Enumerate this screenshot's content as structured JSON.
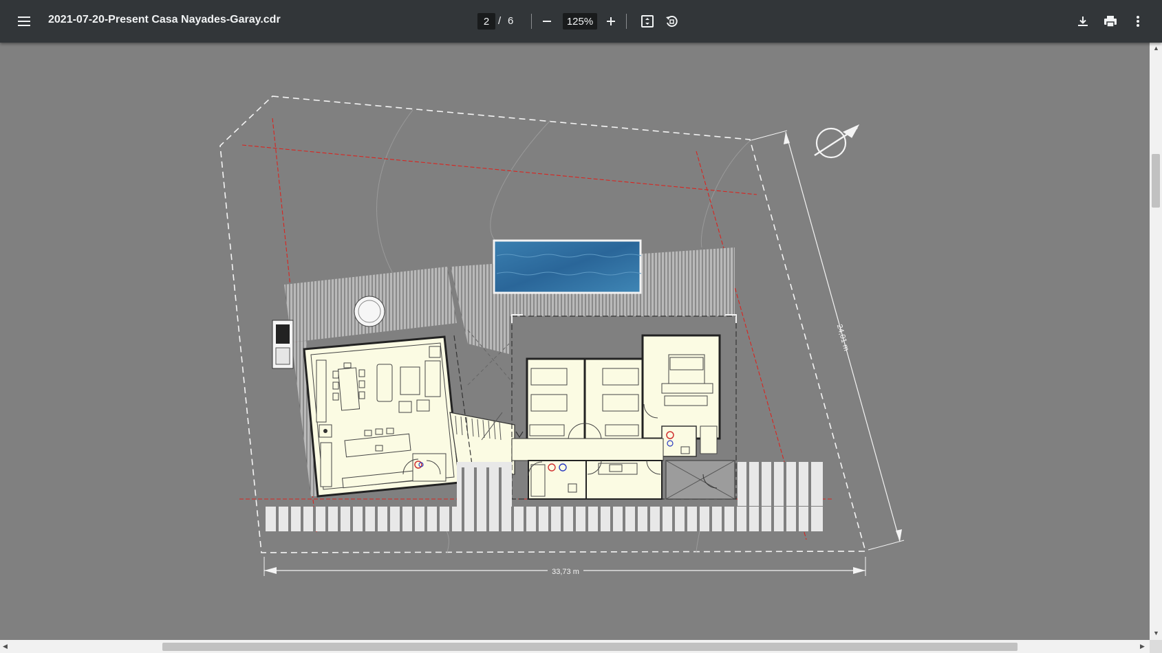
{
  "toolbar": {
    "menu_icon": "hamburger-menu-icon",
    "title": "2021-07-20-Present Casa Nayades-Garay.cdr",
    "page_current": "2",
    "page_separator": "/",
    "page_total": "6",
    "zoom_out_icon": "minus-icon",
    "zoom_value": "125%",
    "zoom_in_icon": "plus-icon",
    "fit_icon": "fit-to-page-icon",
    "rotate_icon": "rotate-counterclockwise-icon",
    "download_icon": "download-icon",
    "print_icon": "print-icon",
    "more_icon": "more-vertical-icon"
  },
  "drawing": {
    "width_dimension": "33,73 m",
    "depth_dimension": "24,01 m",
    "north_icon": "north-arrow-icon"
  },
  "colors": {
    "toolbar_bg": "#323639",
    "viewer_bg": "#808080",
    "room_fill": "#fbfbe3",
    "axis_line": "#d9241f",
    "pool_water": "#2f6fa0"
  }
}
